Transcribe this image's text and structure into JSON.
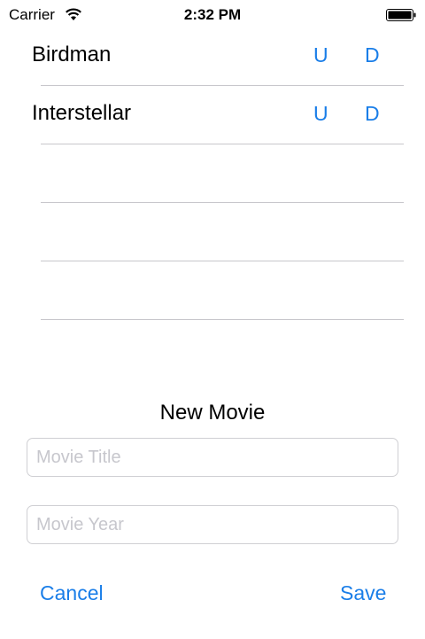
{
  "status_bar": {
    "carrier": "Carrier",
    "time": "2:32 PM",
    "wifi_icon": "wifi-icon",
    "battery_icon": "battery-full-icon"
  },
  "movies": [
    {
      "title": "Birdman",
      "up_label": "U",
      "down_label": "D"
    },
    {
      "title": "Interstellar",
      "up_label": "U",
      "down_label": "D"
    }
  ],
  "form": {
    "title": "New Movie",
    "title_field": {
      "value": "",
      "placeholder": "Movie Title"
    },
    "year_field": {
      "value": "",
      "placeholder": "Movie Year"
    },
    "cancel_label": "Cancel",
    "save_label": "Save"
  },
  "colors": {
    "accent": "#1a7ee8",
    "separator": "#c8c7cc",
    "placeholder": "#c7c7cd"
  }
}
